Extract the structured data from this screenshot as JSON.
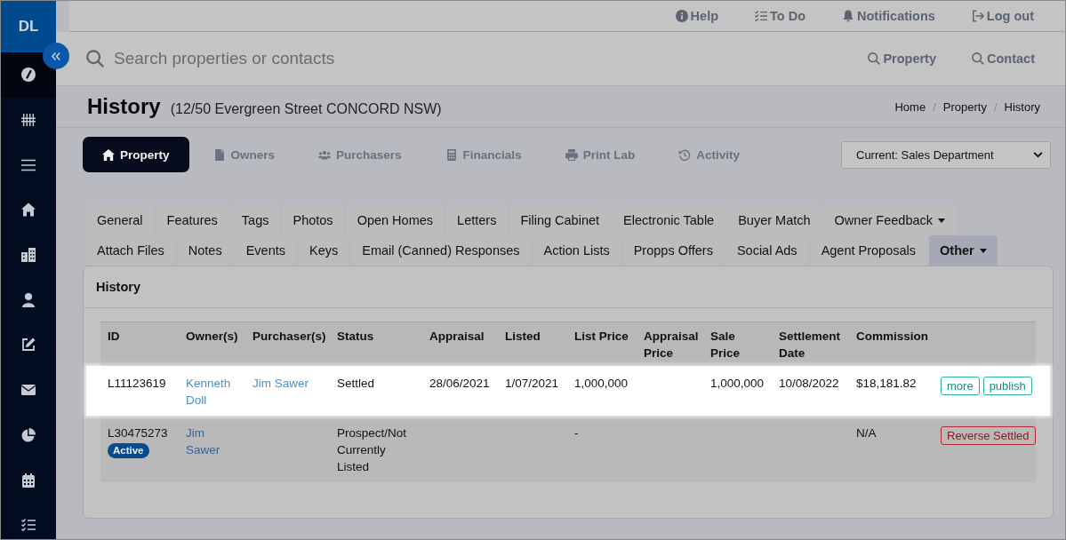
{
  "sidebar": {
    "logo": "DL",
    "items": [
      {
        "selected": true
      },
      {
        "selected": false
      },
      {
        "selected": false
      },
      {
        "selected": false
      },
      {
        "selected": false
      },
      {
        "selected": false
      },
      {
        "selected": false
      },
      {
        "selected": false
      },
      {
        "selected": false
      },
      {
        "selected": false
      },
      {
        "selected": false
      }
    ]
  },
  "top_links": [
    {
      "label": "Help"
    },
    {
      "label": "To Do"
    },
    {
      "label": "Notifications"
    },
    {
      "label": "Log out"
    }
  ],
  "search": {
    "placeholder": "Search properties or contacts",
    "scopes": [
      {
        "label": "Property"
      },
      {
        "label": "Contact"
      }
    ]
  },
  "page_header": {
    "title": "History",
    "subtitle": "(12/50 Evergreen Street CONCORD NSW)",
    "breadcrumb": {
      "items": [
        "Home",
        "Property",
        "History"
      ],
      "separator": "/"
    }
  },
  "section_tabs": [
    {
      "label": "Property",
      "selected": true
    },
    {
      "label": "Owners",
      "selected": false
    },
    {
      "label": "Purchasers",
      "selected": false
    },
    {
      "label": "Financials",
      "selected": false
    },
    {
      "label": "Print Lab",
      "selected": false
    },
    {
      "label": "Activity",
      "selected": false
    }
  ],
  "department_select": {
    "value": "Current: Sales Department"
  },
  "record_tabs": {
    "rows": [
      {
        "tabs": [
          {
            "label": "General",
            "selected": false,
            "dropdown": false
          },
          {
            "label": "Features",
            "selected": false,
            "dropdown": false
          },
          {
            "label": "Tags",
            "selected": false,
            "dropdown": false
          },
          {
            "label": "Photos",
            "selected": false,
            "dropdown": false
          },
          {
            "label": "Open Homes",
            "selected": false,
            "dropdown": false
          },
          {
            "label": "Letters",
            "selected": false,
            "dropdown": false
          },
          {
            "label": "Filing Cabinet",
            "selected": false,
            "dropdown": false
          },
          {
            "label": "Electronic Table",
            "selected": false,
            "dropdown": false
          },
          {
            "label": "Buyer Match",
            "selected": false,
            "dropdown": false
          },
          {
            "label": "Owner Feedback",
            "selected": false,
            "dropdown": true
          }
        ]
      },
      {
        "tabs": [
          {
            "label": "Attach Files",
            "selected": false,
            "dropdown": false
          },
          {
            "label": "Notes",
            "selected": false,
            "dropdown": false
          },
          {
            "label": "Events",
            "selected": false,
            "dropdown": false
          },
          {
            "label": "Keys",
            "selected": false,
            "dropdown": false
          },
          {
            "label": "Email (Canned) Responses",
            "selected": false,
            "dropdown": false
          },
          {
            "label": "Action Lists",
            "selected": false,
            "dropdown": false
          },
          {
            "label": "Propps Offers",
            "selected": false,
            "dropdown": false
          },
          {
            "label": "Social Ads",
            "selected": false,
            "dropdown": false
          },
          {
            "label": "Agent Proposals",
            "selected": false,
            "dropdown": false
          },
          {
            "label": "Other",
            "selected": true,
            "dropdown": true
          }
        ]
      }
    ]
  },
  "history_card": {
    "title": "History",
    "table": {
      "columns": [
        "ID",
        "Owner(s)",
        "Purchaser(s)",
        "Status",
        "Appraisal",
        "Listed",
        "List Price",
        "Appraisal Price",
        "Sale Price",
        "Settlement Date",
        "Commission"
      ],
      "rows": [
        {
          "highlighted": true,
          "id": "L11123619",
          "owners": "Kenneth Doll",
          "purchasers": "Jim Sawer",
          "status": "Settled",
          "appraisal": "28/06/2021",
          "listed": "1/07/2021",
          "list_price": "1,000,000",
          "sale_price": "1,000,000",
          "settlement_date": "10/08/2022",
          "commission": "$18,181.82",
          "actions": [
            {
              "label": "more",
              "kind": "success"
            },
            {
              "label": "publish",
              "kind": "success"
            }
          ]
        },
        {
          "highlighted": false,
          "id": "L30475273",
          "badge": "Active",
          "owners": "Jim Sawer",
          "status": "Prospect/Not Currently Listed",
          "list_price": "-",
          "commission": "N/A",
          "actions": [
            {
              "label": "Reverse Settled",
              "kind": "danger"
            }
          ]
        }
      ]
    }
  }
}
